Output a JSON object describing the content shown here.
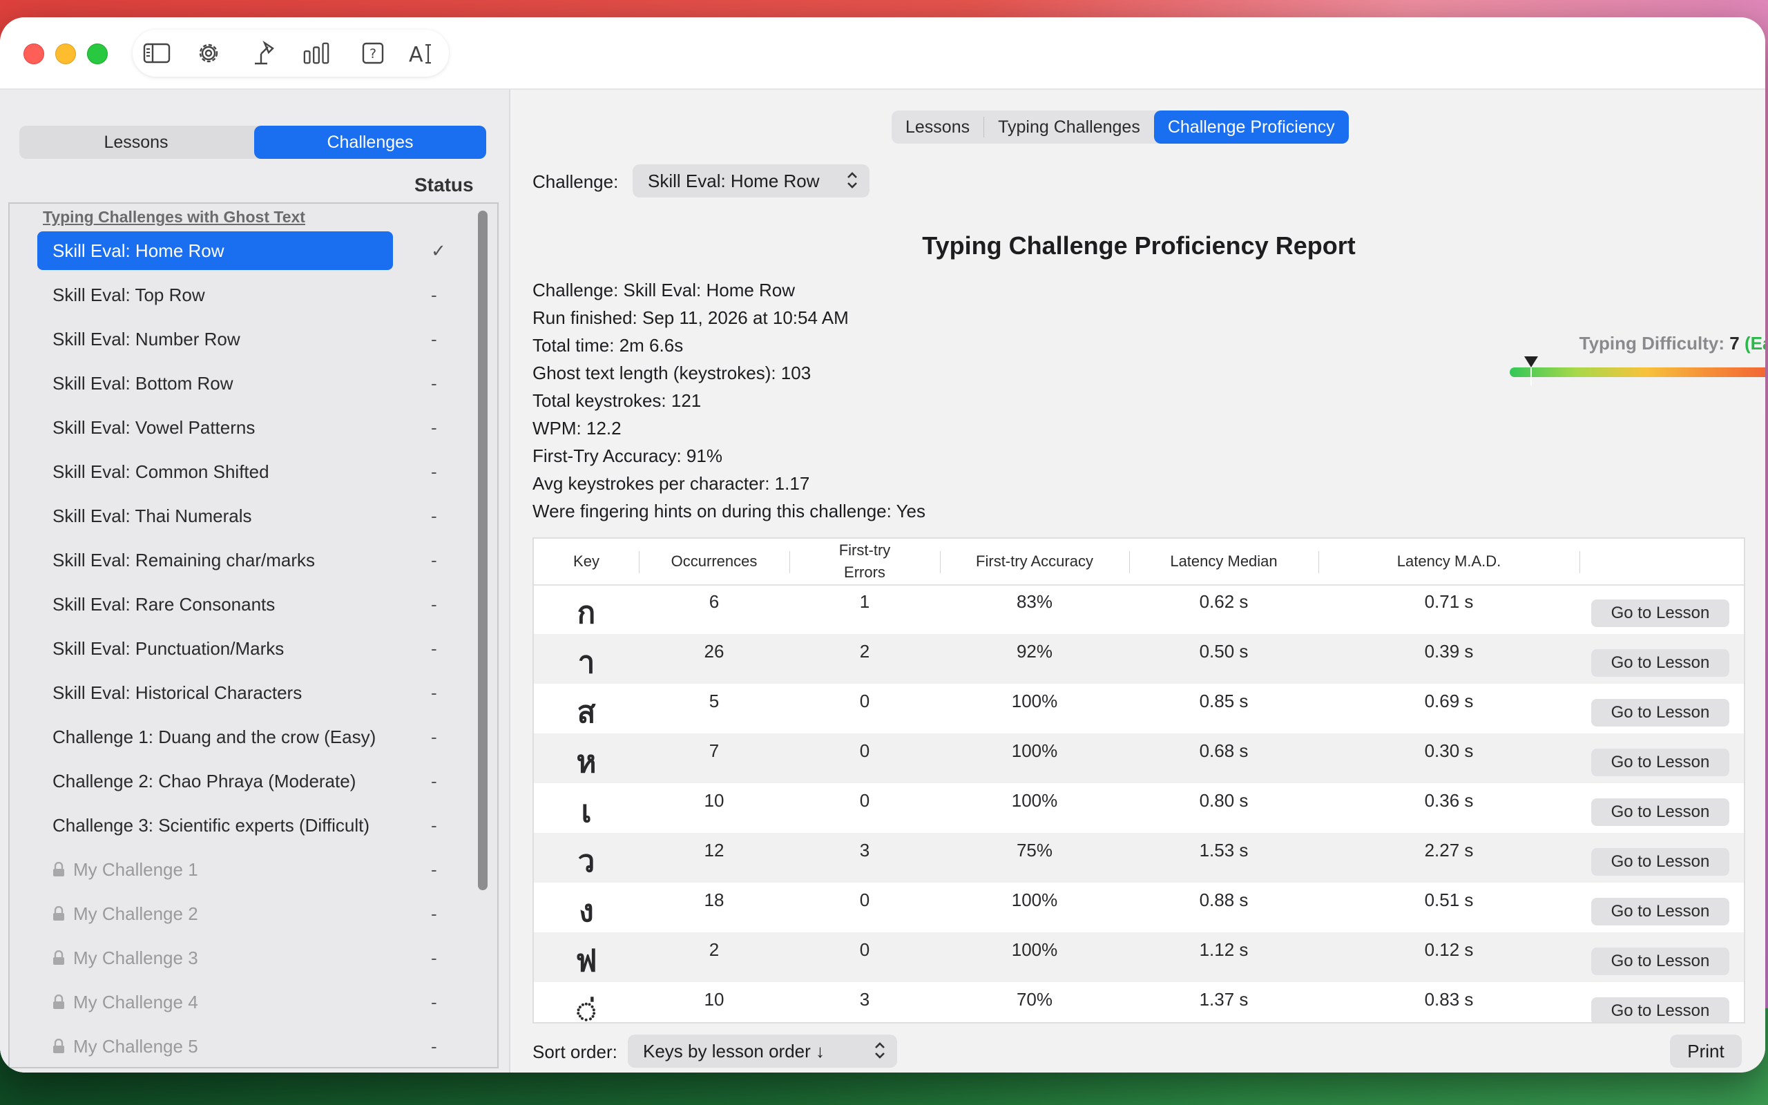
{
  "toolbar": {
    "icons": [
      "sidebar-toggle-icon",
      "gear-icon",
      "lamp-icon",
      "bar-chart-icon",
      "help-icon",
      "text-size-icon"
    ]
  },
  "sidebar": {
    "segments": [
      "Lessons",
      "Challenges"
    ],
    "selected_segment": "Challenges",
    "status_header": "Status",
    "group_header": "Typing Challenges with Ghost Text",
    "items": [
      {
        "label": "Skill Eval: Home Row",
        "status": "✓"
      },
      {
        "label": "Skill Eval: Top Row",
        "status": "-"
      },
      {
        "label": "Skill Eval: Number Row",
        "status": "-"
      },
      {
        "label": "Skill Eval: Bottom Row",
        "status": "-"
      },
      {
        "label": "Skill Eval: Vowel Patterns",
        "status": "-"
      },
      {
        "label": "Skill Eval: Common Shifted",
        "status": "-"
      },
      {
        "label": "Skill Eval: Thai Numerals",
        "status": "-"
      },
      {
        "label": "Skill Eval: Remaining char/marks",
        "status": "-"
      },
      {
        "label": "Skill Eval: Rare Consonants",
        "status": "-"
      },
      {
        "label": "Skill Eval: Punctuation/Marks",
        "status": "-"
      },
      {
        "label": "Skill Eval: Historical Characters",
        "status": "-"
      },
      {
        "label": "Challenge 1: Duang and the crow (Easy)",
        "status": "-"
      },
      {
        "label": "Challenge 2: Chao Phraya (Moderate)",
        "status": "-"
      },
      {
        "label": "Challenge 3: Scientific experts (Difficult)",
        "status": "-"
      },
      {
        "label": "My Challenge 1",
        "status": "-"
      },
      {
        "label": "My Challenge 2",
        "status": "-"
      },
      {
        "label": "My Challenge 3",
        "status": "-"
      },
      {
        "label": "My Challenge 4",
        "status": "-"
      },
      {
        "label": "My Challenge 5",
        "status": "-"
      }
    ]
  },
  "main": {
    "tabs": [
      "Lessons",
      "Typing Challenges",
      "Challenge Proficiency"
    ],
    "active_tab": "Challenge Proficiency",
    "challenge_label": "Challenge:",
    "challenge_value": "Skill Eval: Home Row",
    "report_title": "Typing Challenge Proficiency Report",
    "info_lines": [
      "Challenge: Skill Eval: Home Row",
      "Run finished: Sep 11, 2026 at 10:54 AM",
      "Total time: 2m 6.6s",
      "Ghost text length (keystrokes): 103",
      "Total keystrokes: 121",
      "WPM: 12.2",
      "First-Try Accuracy: 91%",
      "Avg keystrokes per character: 1.17",
      "Were fingering hints on during this challenge: Yes"
    ],
    "difficulty": {
      "label": "Typing Difficulty:",
      "value": "7",
      "level": "(Easy)",
      "fraction": 0.07
    },
    "table": {
      "headers": [
        "Key",
        "Occurrences",
        "First-try Errors",
        "First-try Accuracy",
        "Latency Median",
        "Latency M.A.D."
      ],
      "button_label": "Go to Lesson",
      "rows": [
        {
          "key": "ก",
          "occ": "6",
          "err": "1",
          "acc": "83%",
          "med": "0.62 s",
          "mad": "0.71 s"
        },
        {
          "key": "า",
          "occ": "26",
          "err": "2",
          "acc": "92%",
          "med": "0.50 s",
          "mad": "0.39 s"
        },
        {
          "key": "ส",
          "occ": "5",
          "err": "0",
          "acc": "100%",
          "med": "0.85 s",
          "mad": "0.69 s"
        },
        {
          "key": "ห",
          "occ": "7",
          "err": "0",
          "acc": "100%",
          "med": "0.68 s",
          "mad": "0.30 s"
        },
        {
          "key": "เ",
          "occ": "10",
          "err": "0",
          "acc": "100%",
          "med": "0.80 s",
          "mad": "0.36 s"
        },
        {
          "key": "ว",
          "occ": "12",
          "err": "3",
          "acc": "75%",
          "med": "1.53 s",
          "mad": "2.27 s"
        },
        {
          "key": "ง",
          "occ": "18",
          "err": "0",
          "acc": "100%",
          "med": "0.88 s",
          "mad": "0.51 s"
        },
        {
          "key": "ฟ",
          "occ": "2",
          "err": "0",
          "acc": "100%",
          "med": "1.12 s",
          "mad": "0.12 s"
        },
        {
          "key": "◌่",
          "occ": "10",
          "err": "3",
          "acc": "70%",
          "med": "1.37 s",
          "mad": "0.83 s"
        }
      ]
    },
    "sort_label": "Sort order:",
    "sort_value": "Keys by lesson order ↓",
    "print_label": "Print"
  },
  "colors": {
    "accent": "#1a6ef0",
    "easy": "#2bb84a"
  }
}
